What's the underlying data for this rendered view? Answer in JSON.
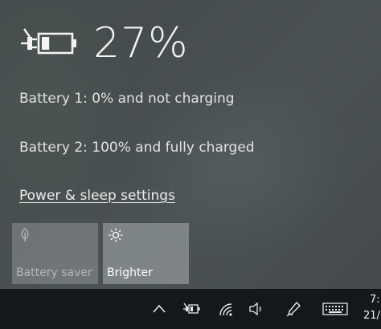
{
  "battery": {
    "percent_label": "27%",
    "percent": 27,
    "battery1_status": "Battery 1: 0% and not charging",
    "battery2_status": "Battery 2: 100% and fully charged"
  },
  "links": {
    "power_settings": "Power & sleep settings"
  },
  "quick_actions": [
    {
      "label": "Battery saver",
      "icon": "leaf-icon",
      "state": "disabled"
    },
    {
      "label": "Brighter",
      "icon": "sun-icon",
      "state": "active"
    }
  ],
  "taskbar": {
    "tray_icons": [
      "chevron-up-icon",
      "battery-plug-icon",
      "wifi-icon",
      "speaker-icon",
      "pen-icon",
      "keyboard-icon"
    ],
    "clock_time": "7:",
    "clock_date": "21/"
  },
  "colors": {
    "flyout_text": "#e2e2e2",
    "taskbar_bg": "#15181b"
  }
}
